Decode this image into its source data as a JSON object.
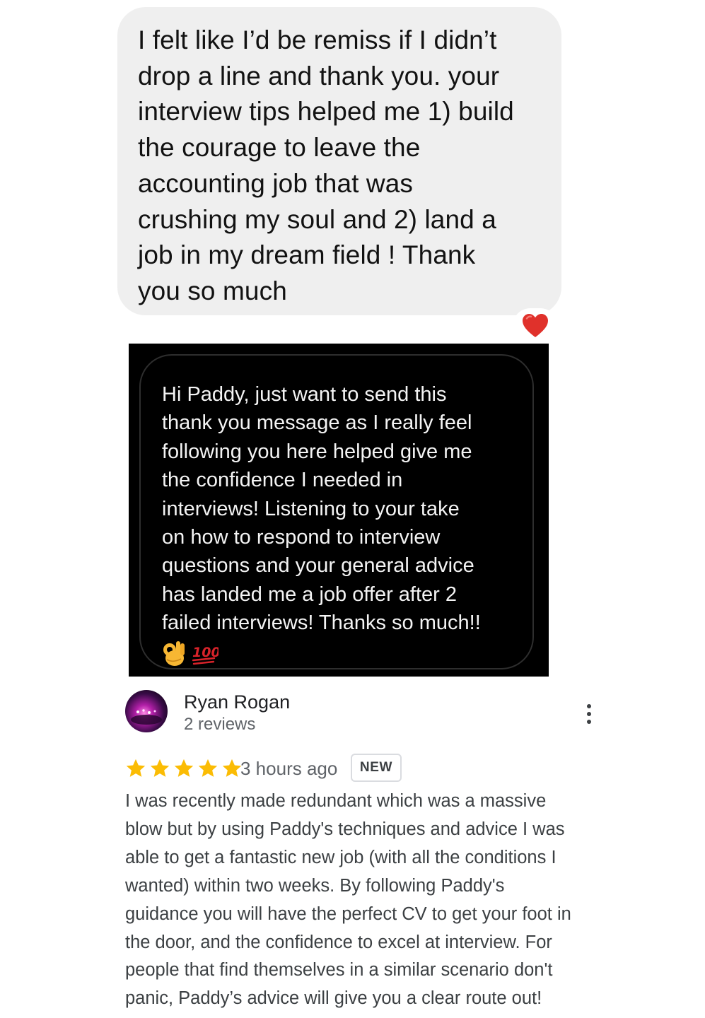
{
  "message_1": {
    "text": "I felt like I’d be remiss if I didn’t\ndrop a line and thank you. your\ninterview tips helped me 1) build\nthe courage to leave the\naccounting job that was\ncrushing my soul and 2) land a\njob in my dream field ! Thank\nyou so much",
    "reaction": "heart-icon"
  },
  "message_2": {
    "text": "Hi Paddy, just want to send this\nthank you message as I really feel\nfollowing you here helped give me\nthe confidence I needed in\ninterviews! Listening to your take\non how to respond to interview\nquestions and your general advice\nhas landed me a job offer after 2\nfailed interviews! Thanks so much!!",
    "emojis": [
      "ok-hand-icon",
      "hundred-points-icon"
    ]
  },
  "review": {
    "reviewer_name": "Ryan Rogan",
    "review_count": "2 reviews",
    "rating": 5,
    "rating_max": 5,
    "star_color": "#fbbc04",
    "time": "3 hours ago",
    "badge": "NEW",
    "text": "I was recently made redundant which was a massive\nblow but by using Paddy's techniques and advice I was\nable to get a fantastic new job (with all the conditions I\nwanted) within two weeks. By following Paddy's\nguidance you will have the perfect CV to get your foot in\nthe door, and the confidence to excel at interview. For\npeople that find themselves in a similar scenario don't\npanic, Paddy’s advice will give you a clear route out!"
  }
}
